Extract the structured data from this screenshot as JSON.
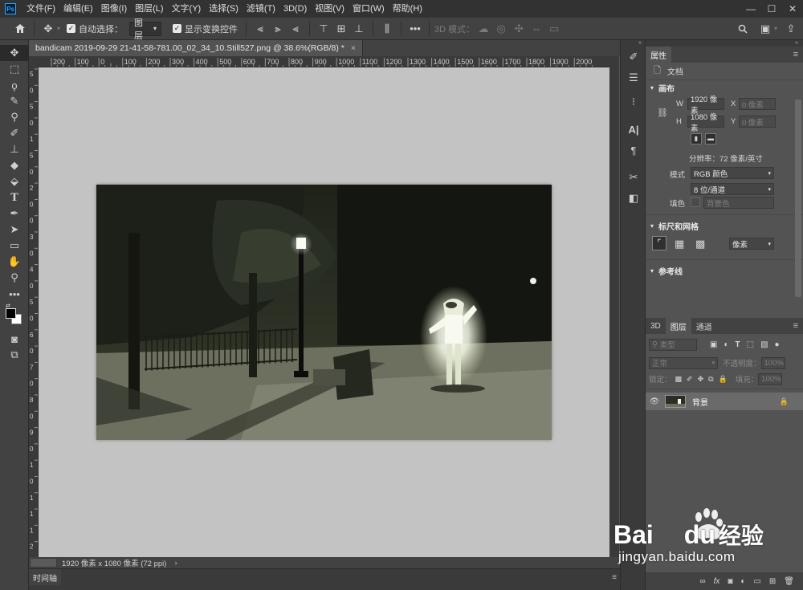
{
  "app": {
    "logo": "Ps"
  },
  "menu": [
    "文件(F)",
    "编辑(E)",
    "图像(I)",
    "图层(L)",
    "文字(Y)",
    "选择(S)",
    "滤镜(T)",
    "3D(D)",
    "视图(V)",
    "窗口(W)",
    "帮助(H)"
  ],
  "window_controls": [
    "—",
    "☐",
    "✕"
  ],
  "options": {
    "auto_select_label": "自动选择：",
    "auto_select_value": "图层",
    "show_transform_label": "显示变换控件",
    "mode_3d_label": "3D 模式："
  },
  "document": {
    "tab_title": "bandicam 2019-09-29 21-41-58-781.00_02_34_10.Still527.png @ 38.6%(RGB/8) *",
    "close": "×"
  },
  "rulers": {
    "h_ticks": [
      "200",
      "100",
      "0",
      "100",
      "200",
      "300",
      "400",
      "500",
      "600",
      "700",
      "800",
      "900",
      "1000",
      "1100",
      "1200",
      "1300",
      "1400",
      "1500",
      "1600",
      "1700",
      "1800",
      "1900",
      "2000"
    ],
    "v_ticks": [
      "5",
      "0",
      "5",
      "0",
      "1",
      "5",
      "0",
      "2",
      "0",
      "0",
      "3",
      "0",
      "4",
      "0",
      "5",
      "0",
      "6",
      "0",
      "7",
      "0",
      "8",
      "0",
      "9",
      "0",
      "1",
      "0",
      "1",
      "1",
      "1",
      "2"
    ]
  },
  "status": {
    "zoom": "38.6%",
    "info": "1920 像素 x 1080 像素 (72 ppi)",
    "arrow": "›"
  },
  "timeline": {
    "tab": "时间轴"
  },
  "properties": {
    "tab": "属性",
    "doc_label": "文档",
    "canvas_section": "画布",
    "w_label": "W",
    "w_value": "1920 像素",
    "x_label": "X",
    "x_placeholder": "0 像素",
    "h_label": "H",
    "h_value": "1080 像素",
    "y_label": "Y",
    "y_placeholder": "0 像素",
    "resolution": "分辨率：72 像素/英寸",
    "mode_label": "模式",
    "mode_value": "RGB 颜色",
    "depth_value": "8 位/通道",
    "fill_label": "填色",
    "fill_value": "背景色",
    "rulers_section": "标尺和网格",
    "units_value": "像素",
    "guides_section": "参考线"
  },
  "layers": {
    "tabs": [
      "3D",
      "图层",
      "通道"
    ],
    "filter_placeholder": "类型",
    "blend_mode": "正常",
    "opacity_label": "不透明度：",
    "opacity_value": "100%",
    "lock_label": "锁定：",
    "fill_label": "填充：",
    "fill_value": "100%",
    "layer_name": "背景"
  },
  "watermark": {
    "text1": "Bai",
    "text2": "du",
    "text3": "经验",
    "url": "jingyan.baidu.com"
  },
  "colors": {
    "chrome_dark": "#323232",
    "panel": "#424242",
    "workspace": "#535353",
    "canvas_bg": "#c3c3c3",
    "accent": "#31a8ff"
  }
}
